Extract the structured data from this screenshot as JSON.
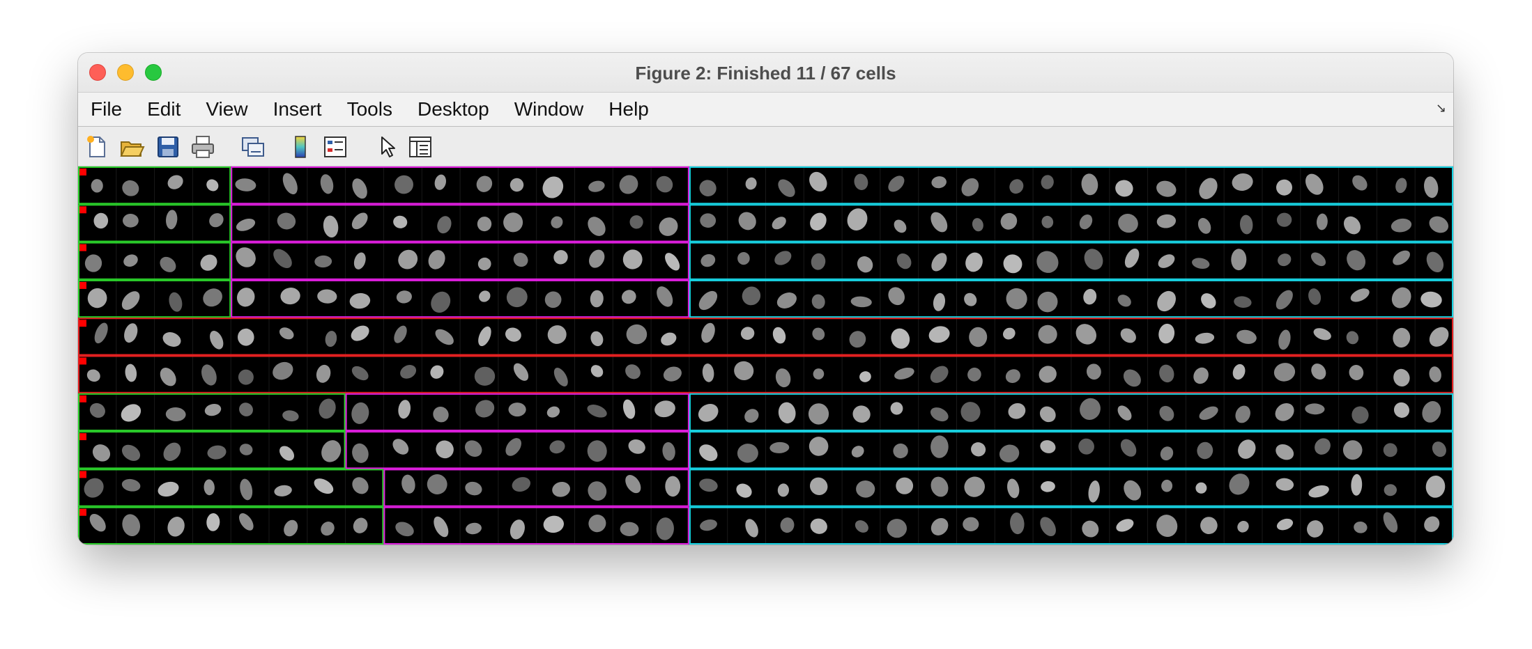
{
  "window": {
    "title": "Figure 2: Finished 11 / 67 cells"
  },
  "menubar": {
    "items": [
      "File",
      "Edit",
      "View",
      "Insert",
      "Tools",
      "Desktop",
      "Window",
      "Help"
    ]
  },
  "toolbar": {
    "tools": [
      "new-figure-icon",
      "open-file-icon",
      "save-icon",
      "print-icon",
      "link-plot-icon",
      "insert-colorbar-icon",
      "insert-legend-icon",
      "edit-plot-arrow-icon",
      "property-inspector-icon"
    ]
  },
  "montage": {
    "columns": 36,
    "rows": 10,
    "colors": {
      "green": "#2bd12b",
      "magenta": "#e21ee2",
      "cyan": "#18d6e6",
      "red": "#e22020",
      "marker": "#ff0000"
    },
    "row_pairs": [
      {
        "segments": [
          {
            "color": "green",
            "cols": 4
          },
          {
            "color": "magenta",
            "cols": 12
          },
          {
            "color": "cyan",
            "cols": 20
          }
        ]
      },
      {
        "segments": [
          {
            "color": "green",
            "cols": 4
          },
          {
            "color": "magenta",
            "cols": 12
          },
          {
            "color": "cyan",
            "cols": 20
          }
        ]
      },
      {
        "segments": [
          {
            "color": "red",
            "cols": 36
          }
        ]
      },
      {
        "segments": [
          {
            "color": "green",
            "cols": 7
          },
          {
            "color": "magenta",
            "cols": 9
          },
          {
            "color": "cyan",
            "cols": 20
          }
        ]
      },
      {
        "segments": [
          {
            "color": "green",
            "cols": 8
          },
          {
            "color": "magenta",
            "cols": 8
          },
          {
            "color": "cyan",
            "cols": 20
          }
        ]
      }
    ]
  }
}
